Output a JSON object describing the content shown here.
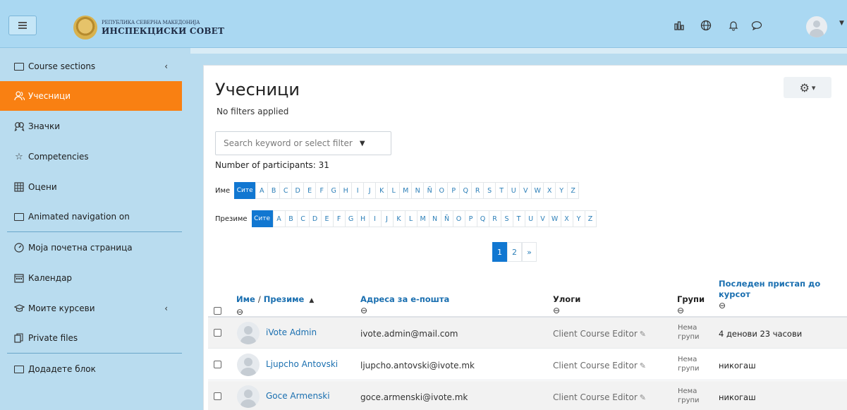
{
  "header": {
    "logo_line1": "РЕПУБЛИКА СЕВЕРНА МАКЕДОНИЈА",
    "logo_line2": "ИНСПЕКЦИСКИ СОВЕТ",
    "icons": [
      "menu-icon",
      "reports-icon",
      "language-icon",
      "notifications-icon",
      "messages-icon",
      "user-avatar",
      "caret-down-icon"
    ]
  },
  "sidebar": {
    "items": [
      {
        "label": "Course sections",
        "icon": "folder-icon",
        "has_chevron": true
      },
      {
        "label": "Учесници",
        "icon": "users-icon",
        "active": true
      },
      {
        "label": "Значки",
        "icon": "badges-icon"
      },
      {
        "label": "Competencies",
        "icon": "star-icon"
      },
      {
        "label": "Оцени",
        "icon": "grades-icon"
      },
      {
        "label": "Animated navigation on",
        "icon": "folder-icon"
      },
      {
        "label": "Моја почетна страница",
        "icon": "dashboard-icon"
      },
      {
        "label": "Календар",
        "icon": "calendar-icon"
      },
      {
        "label": "Моите курсеви",
        "icon": "graduation-cap-icon",
        "has_chevron": true
      },
      {
        "label": "Private files",
        "icon": "files-icon"
      },
      {
        "label": "Додадете блок",
        "icon": "folder-icon"
      }
    ],
    "chevron": "‹"
  },
  "main": {
    "title": "Учесници",
    "filters_note": "No filters applied",
    "search_placeholder": "Search keyword or select filter",
    "search_arrow": "▼",
    "participants_count": "Number of participants: 31",
    "gear_caret": "▾",
    "firstname_label": "Име",
    "lastname_label": "Презиме",
    "all_label": "Сите",
    "letters": [
      "A",
      "B",
      "C",
      "D",
      "E",
      "F",
      "G",
      "H",
      "I",
      "J",
      "K",
      "L",
      "M",
      "N",
      "Ñ",
      "O",
      "P",
      "Q",
      "R",
      "S",
      "T",
      "U",
      "V",
      "W",
      "X",
      "Y",
      "Z"
    ],
    "pagination": {
      "current": "1",
      "next": "2",
      "next_arrow": "»"
    }
  },
  "table": {
    "headers": {
      "name": "Име",
      "name_sep": "/",
      "surname": "Презиме",
      "sort_arrow": "▲",
      "email": "Адреса за е-пошта",
      "roles": "Улоги",
      "groups": "Групи",
      "last_access_line1": "Последен пристап до",
      "last_access_line2": "курсот",
      "collapse_icon": "⊖"
    },
    "rows": [
      {
        "name": "iVote Admin",
        "email": "ivote.admin@mail.com",
        "role": "Client Course Editor",
        "groups_l1": "Нема",
        "groups_l2": "групи",
        "last_access": "4 денови 23 часови"
      },
      {
        "name": "Ljupcho Antovski",
        "email": "ljupcho.antovski@ivote.mk",
        "role": "Client Course Editor",
        "groups_l1": "Нема",
        "groups_l2": "групи",
        "last_access": "никогаш"
      },
      {
        "name": "Goce Armenski",
        "email": "goce.armenski@ivote.mk",
        "role": "Client Course Editor",
        "groups_l1": "Нема",
        "groups_l2": "групи",
        "last_access": "никогаш"
      }
    ],
    "edit_icon": "✎"
  }
}
